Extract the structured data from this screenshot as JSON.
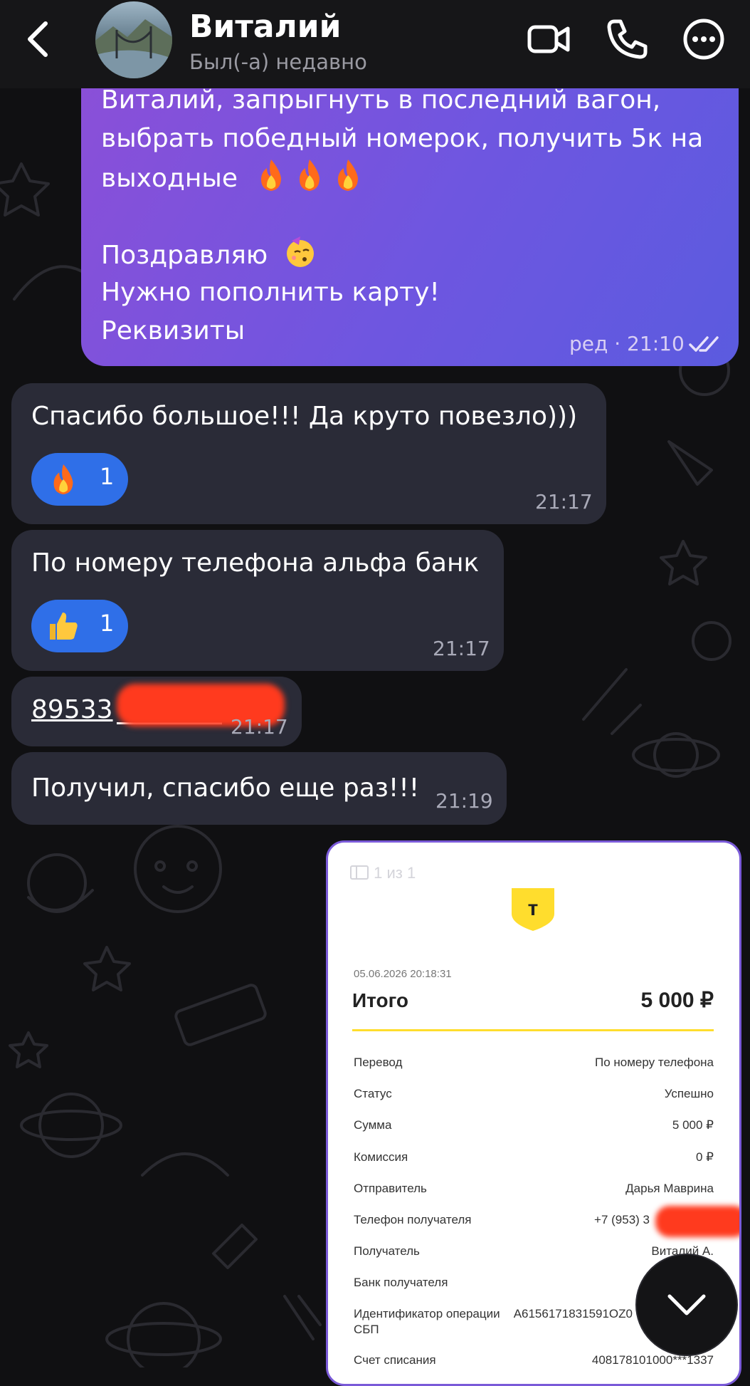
{
  "header": {
    "contact_name": "Виталий",
    "status": "Был(-а) недавно",
    "icons": [
      "back-chevron-icon",
      "video-call-icon",
      "phone-icon",
      "more-icon"
    ]
  },
  "messages": {
    "m1": {
      "line1": "Виталий, запрыгнуть в последний вагон,",
      "line2": "выбрать победный номерок, получить 5к на",
      "line3": "выходные",
      "line4": "Поздравляю",
      "line5": "Нужно пополнить карту!",
      "line6": "Реквизиты",
      "meta": "ред · 21:10"
    },
    "m2": {
      "text": "Спасибо большое!!! Да круто повезло)))",
      "reaction_count": "1",
      "reaction_icon": "fire-icon",
      "time": "21:17"
    },
    "m3": {
      "text": "По номеру телефона альфа банк",
      "reaction_count": "1",
      "reaction_icon": "thumbs-up-icon",
      "time": "21:17"
    },
    "m4": {
      "text": "89533",
      "time": "21:17"
    },
    "m5": {
      "text": "Получил, спасибо еще раз!!!",
      "time": "21:19"
    }
  },
  "receipt": {
    "pages": "1 из 1",
    "logo_letter": "т",
    "datetime": "05.06.2026  20:18:31",
    "total_label": "Итого",
    "total_value": "5 000 ₽",
    "rows": [
      {
        "label": "Перевод",
        "value": "По номеру телефона"
      },
      {
        "label": "Статус",
        "value": "Успешно"
      },
      {
        "label": "Сумма",
        "value": "5 000 ₽"
      },
      {
        "label": "Комиссия",
        "value": "0 ₽"
      },
      {
        "label": "Отправитель",
        "value": "Дарья Маврина"
      },
      {
        "label": "Телефон получателя",
        "value": "+7 (953) 3"
      },
      {
        "label": "Получатель",
        "value": "Виталий А."
      },
      {
        "label": "Банк получателя",
        "value": ""
      },
      {
        "label": "Идентификатор операции",
        "value": "A6156171831591OZ0"
      },
      {
        "label": "СБП",
        "value": ""
      },
      {
        "label": "Счет списания",
        "value": "408178101000***1337"
      }
    ]
  },
  "colors": {
    "background": "#101012",
    "incoming_bubble": "#2a2b37",
    "outgoing_gradient_start": "#8b4fd8",
    "outgoing_gradient_end": "#5b5bdf",
    "reaction": "#2f6fe8",
    "bank_yellow": "#ffdd2d"
  }
}
